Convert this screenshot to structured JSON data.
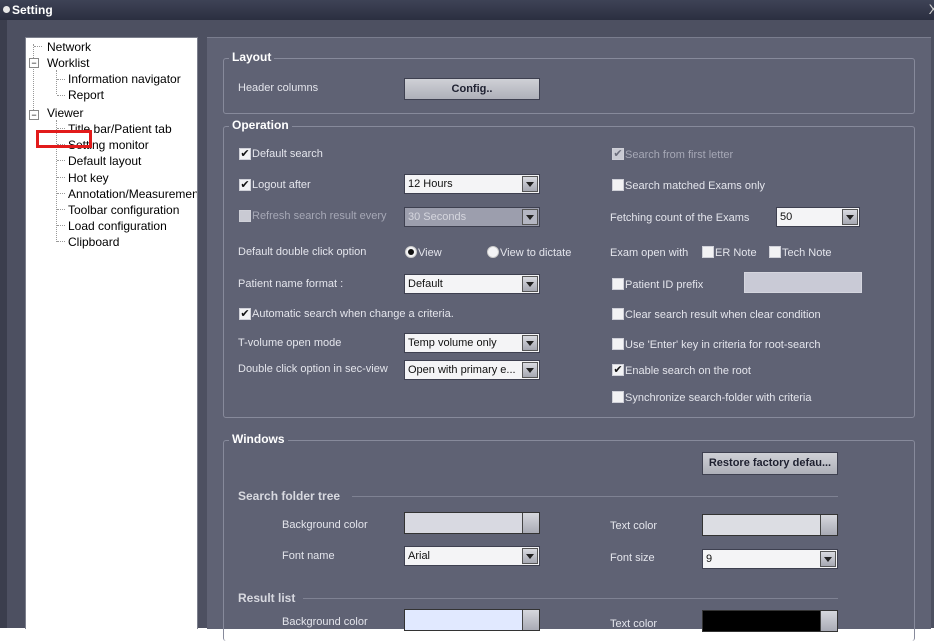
{
  "window": {
    "title": "Setting",
    "close": "X"
  },
  "tree": {
    "network": "Network",
    "worklist": "Worklist",
    "info_nav": "Information navigator",
    "report": "Report",
    "viewer": "Viewer",
    "titlebar_tab": "Title bar/Patient tab",
    "setting_monitor": "Setting monitor",
    "default_layout": "Default layout",
    "hot_key": "Hot key",
    "annotation": "Annotation/Measurement",
    "toolbar_config": "Toolbar configuration",
    "load_config": "Load configuration",
    "clipboard": "Clipboard",
    "collapse_glyph": "−"
  },
  "layout": {
    "title": "Layout",
    "header_columns": "Header columns",
    "config_button": "Config.."
  },
  "operation": {
    "title": "Operation",
    "default_search": "Default search",
    "logout_after": "Logout after",
    "logout_value": "12 Hours",
    "refresh_search": "Refresh search result every",
    "refresh_value": "30 Seconds",
    "default_double_click": "Default double click option",
    "radio_view": "View",
    "radio_view_dictate": "View to dictate",
    "patient_name_format": "Patient name format :",
    "patient_name_value": "Default",
    "automatic_search": "Automatic search when change a criteria.",
    "tvolume_mode": "T-volume open mode",
    "tvolume_value": "Temp volume only",
    "double_click_sec": "Double click option in sec-view",
    "double_click_sec_value": "Open with primary e...",
    "search_first_letter": "Search from first letter",
    "search_matched": "Search matched Exams only",
    "fetching_count": "Fetching count of the Exams",
    "fetching_value": "50",
    "exam_open_with": "Exam open with",
    "er_note": "ER Note",
    "tech_note": "Tech Note",
    "patient_id_prefix": "Patient ID prefix",
    "clear_search": "Clear search result when clear condition",
    "use_enter": "Use 'Enter' key in criteria for root-search",
    "enable_root": "Enable search on the root",
    "sync_folder": "Synchronize search-folder with criteria",
    "check_glyph": "✔"
  },
  "windows": {
    "title": "Windows",
    "restore_button": "Restore factory defau...",
    "search_folder_tree": "Search folder tree",
    "bg_color": "Background color",
    "text_color": "Text color",
    "font_name": "Font name",
    "font_name_value": "Arial",
    "font_size": "Font size",
    "font_size_value": "9",
    "result_list": "Result list",
    "result_bg_color": "Background color",
    "result_text_color": "Text color"
  },
  "colors": {
    "sft_bg": "#d8d9e1",
    "sft_text": "#dcdde3",
    "rl_bg": "#e1e9ff",
    "rl_text": "#000000",
    "highlight": "#e21b1b"
  }
}
